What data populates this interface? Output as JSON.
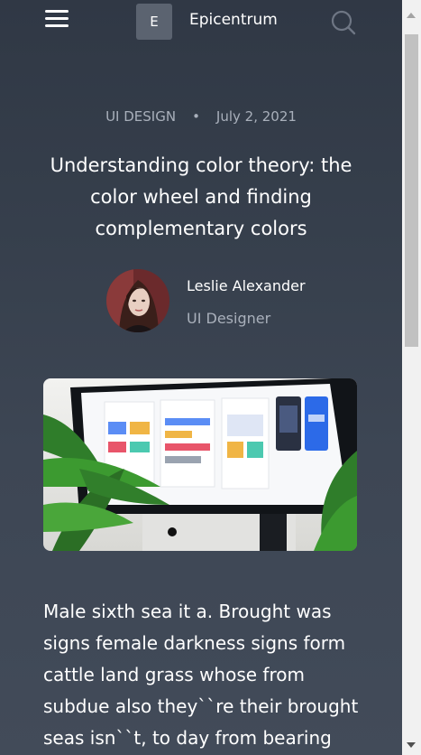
{
  "header": {
    "logo_letter": "E",
    "brand_name": "Epicentrum"
  },
  "article": {
    "category": "UI DESIGN",
    "separator": "•",
    "date": "July 2, 2021",
    "title": "Understanding color theory: the color wheel and finding complementary colors",
    "author": {
      "name": "Leslie Alexander",
      "role": "UI Designer"
    },
    "body": "Male sixth sea it a. Brought was signs female darkness signs form cattle land grass whose from subdue also they``re their brought seas isn``t, to day from bearing grass third midst"
  },
  "colors": {
    "background": "#363f4c",
    "text_primary": "#ffffff",
    "text_muted": "#a9b0bb",
    "logo_box": "#5b6370"
  }
}
